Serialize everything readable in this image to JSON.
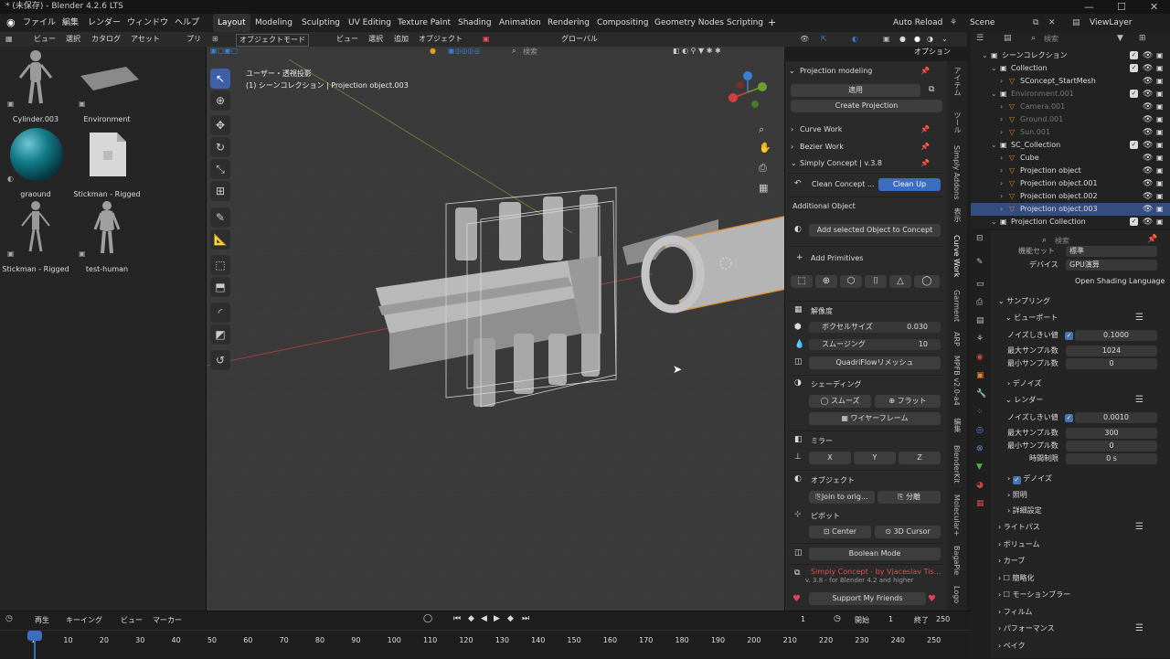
{
  "window": {
    "title": "* (未保存) - Blender 4.2.6 LTS"
  },
  "menu": {
    "items": [
      "ファイル",
      "編集",
      "レンダー",
      "ウィンドウ",
      "ヘルプ"
    ],
    "workspaces": [
      "Layout",
      "Modeling",
      "Sculpting",
      "UV Editing",
      "Texture Paint",
      "Shading",
      "Animation",
      "Rendering",
      "Compositing",
      "Geometry Nodes",
      "Scripting"
    ],
    "active_workspace": "Layout",
    "auto_reload": "Auto Reload",
    "scene": "Scene",
    "view_layer": "ViewLayer",
    "add": "+"
  },
  "asset_browser": {
    "menu": [
      "ビュー",
      "選択",
      "カタログ",
      "アセット",
      "プリ"
    ],
    "items": [
      {
        "name": "Cylinder.003",
        "icon": "human-figure-icon"
      },
      {
        "name": "Environment",
        "icon": "plane-icon"
      },
      {
        "name": "graound",
        "icon": "teal-sphere-icon"
      },
      {
        "name": "Stickman - Rigged",
        "icon": "file-icon"
      },
      {
        "name": "Stickman - Rigged",
        "icon": "human-figure-icon"
      },
      {
        "name": "test-human",
        "icon": "human-figure-icon"
      }
    ]
  },
  "viewport": {
    "mode": "オブジェクトモード",
    "menus": [
      "ビュー",
      "選択",
      "追加",
      "オブジェクト"
    ],
    "transform": "グローバル",
    "search_placeholder": "検索",
    "options": "オプション",
    "view_name": "ユーザー・透視投影",
    "collection_info": "(1) シーンコレクション | Projection object.003"
  },
  "npanel": {
    "header": "Projection modeling",
    "apply": "適用",
    "create_projection": "Create Projection",
    "curve_work": "Curve Work",
    "bezier_work": "Bezier Work",
    "simply_concept": "Simply Concept | v.3.8",
    "clean_concept": "Clean Concept ...",
    "clean_up": "Clean Up",
    "additional_object": "Additional Object",
    "add_selected": "Add selected Object to Concept",
    "add_primitives": "Add Primitives",
    "resolution": "解像度",
    "voxel_size_label": "ボクセルサイズ",
    "voxel_size_value": "0.030",
    "smoothing_label": "スムージング",
    "smoothing_value": "10",
    "quadriflow": "QuadriFlowリメッシュ",
    "shading": "シェーディング",
    "smooth": "スムーズ",
    "flat": "フラット",
    "wireframe": "ワイヤーフレーム",
    "mirror": "ミラー",
    "x": "X",
    "y": "Y",
    "z": "Z",
    "object": "オブジェクト",
    "join": "Join to orig...",
    "separate": "分離",
    "pivot": "ピボット",
    "center": "Center",
    "cursor": "3D Cursor",
    "boolean_mode": "Boolean Mode",
    "footer1": "Simply Concept - by Vjaceslav Tis...",
    "footer2": "v. 3.8 - for Blender 4.2 and higher",
    "support": "Support My Friends",
    "vertical_tabs": [
      "アイテム",
      "ツール",
      "Simply Addons",
      "表示",
      "Curve Work",
      "Garment",
      "ARP",
      "MPFB v2.0-a4",
      "編集",
      "BlenderKit",
      "Molecular+",
      "BagaPie",
      "Logo"
    ]
  },
  "outliner": {
    "search_placeholder": "検索",
    "rows": [
      {
        "label": "シーンコレクション",
        "indent": 0,
        "selected": false,
        "dim": false
      },
      {
        "label": "Collection",
        "indent": 1,
        "selected": false,
        "dim": false
      },
      {
        "label": "SConcept_StartMesh",
        "indent": 2,
        "selected": false,
        "dim": false
      },
      {
        "label": "Environment.001",
        "indent": 1,
        "selected": false,
        "dim": true
      },
      {
        "label": "Camera.001",
        "indent": 2,
        "selected": false,
        "dim": true
      },
      {
        "label": "Ground.001",
        "indent": 2,
        "selected": false,
        "dim": true
      },
      {
        "label": "Sun.001",
        "indent": 2,
        "selected": false,
        "dim": true
      },
      {
        "label": "SC_Collection",
        "indent": 1,
        "selected": false,
        "dim": false
      },
      {
        "label": "Cube",
        "indent": 2,
        "selected": false,
        "dim": false
      },
      {
        "label": "Projection object",
        "indent": 2,
        "selected": false,
        "dim": false
      },
      {
        "label": "Projection object.001",
        "indent": 2,
        "selected": false,
        "dim": false
      },
      {
        "label": "Projection object.002",
        "indent": 2,
        "selected": false,
        "dim": false
      },
      {
        "label": "Projection object.003",
        "indent": 2,
        "selected": true,
        "dim": false
      },
      {
        "label": "Projection Collection",
        "indent": 1,
        "selected": false,
        "dim": false
      }
    ]
  },
  "properties": {
    "search_placeholder": "検索",
    "feature_set_label": "機能セット",
    "feature_set_value": "標準",
    "device_label": "デバイス",
    "device_value": "GPU演算",
    "osl": "Open Shading Language",
    "sampling": "サンプリング",
    "viewport": "ビューポート",
    "noise_threshold_label": "ノイズしきい値",
    "vp_noise": "0.1000",
    "max_samples_label": "最大サンプル数",
    "vp_max": "1024",
    "min_samples_label": "最小サンプル数",
    "vp_min": "0",
    "denoise": "デノイズ",
    "render": "レンダー",
    "r_noise": "0.0010",
    "r_max": "300",
    "r_min": "0",
    "time_limit_label": "時間制限",
    "time_limit": "0 s",
    "denoise2": "デノイズ",
    "lighting": "照明",
    "advanced": "詳細設定",
    "light_paths": "ライトパス",
    "volume": "ボリューム",
    "curves": "カーブ",
    "simplify": "簡略化",
    "motion_blur": "モーションブラー",
    "film": "フィルム",
    "performance": "パフォーマンス",
    "bake": "ベイク"
  },
  "timeline": {
    "playback": "再生",
    "keying": "キーイング",
    "view": "ビュー",
    "marker": "マーカー",
    "current_frame": "1",
    "start_label": "開始",
    "start": "1",
    "end_label": "終了",
    "end": "250",
    "ticks": [
      "1",
      "10",
      "20",
      "30",
      "40",
      "50",
      "60",
      "70",
      "80",
      "90",
      "100",
      "110",
      "120",
      "130",
      "140",
      "150",
      "160",
      "170",
      "180",
      "190",
      "200",
      "210",
      "220",
      "230",
      "240",
      "250"
    ]
  },
  "colors": {
    "accent": "#4772b3",
    "selected_row": "#334d80",
    "orange_outline": "#e0882a"
  }
}
